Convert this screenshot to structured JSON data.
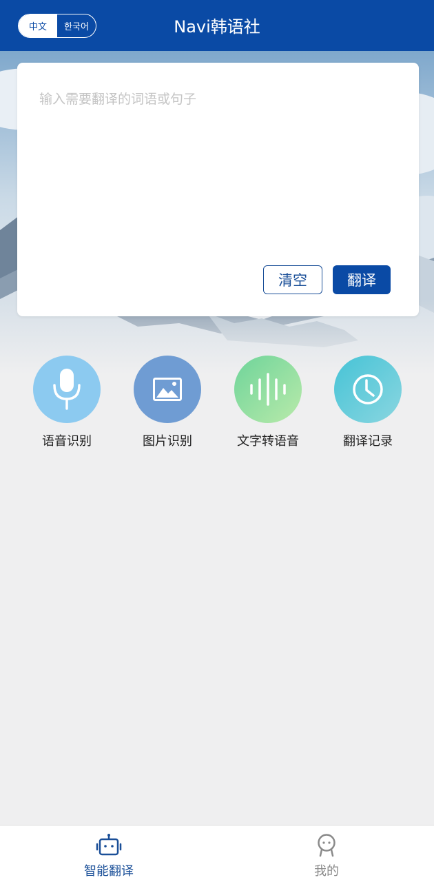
{
  "header": {
    "title": "Navi韩语社",
    "lang_toggle": {
      "active": "中文",
      "inactive": "한국어"
    }
  },
  "input_card": {
    "placeholder": "输入需要翻译的词语或句子",
    "value": "",
    "clear_label": "清空",
    "translate_label": "翻译"
  },
  "features": [
    {
      "label": "语音识别",
      "icon": "microphone-icon",
      "color": "#8ccaf0"
    },
    {
      "label": "图片识别",
      "icon": "image-icon",
      "color": "#6f9cd3"
    },
    {
      "label": "文字转语音",
      "icon": "soundwave-icon",
      "color": "#6ed49a"
    },
    {
      "label": "翻译记录",
      "icon": "clock-icon",
      "color": "#46c3d6"
    }
  ],
  "bottom_nav": {
    "items": [
      {
        "label": "智能翻译",
        "icon": "robot-icon",
        "active": true
      },
      {
        "label": "我的",
        "icon": "profile-face-icon",
        "active": false
      }
    ]
  },
  "colors": {
    "primary": "#0a4aa5",
    "background": "#efeff0",
    "inactive_nav": "#8a8a8a"
  }
}
